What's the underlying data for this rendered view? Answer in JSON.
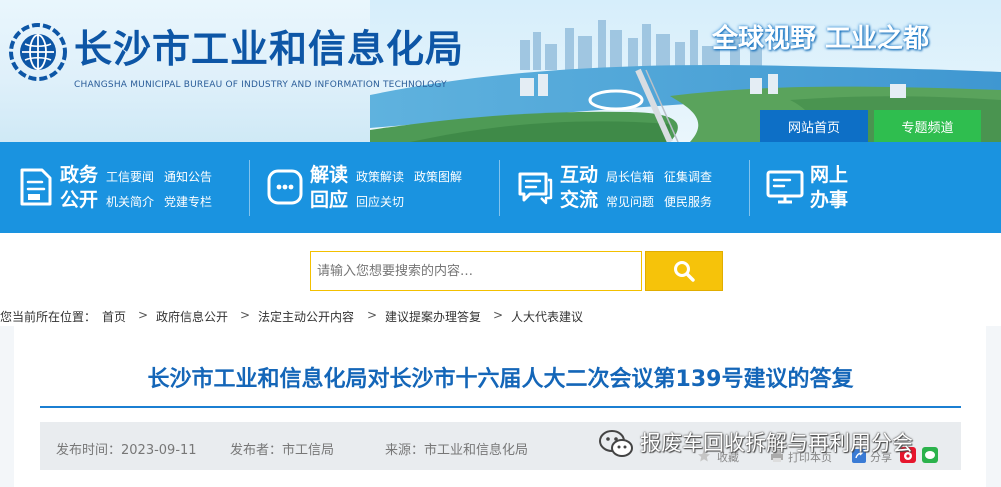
{
  "header": {
    "site_title": "长沙市工业和信息化局",
    "site_subtitle": "CHANGSHA MUNICIPAL BUREAU OF INDUSTRY AND INFORMATION TECHNOLOGY",
    "slogan": "全球视野 工业之都",
    "btn_home": "网站首页",
    "btn_topic": "专题频道",
    "colors": {
      "brand_blue": "#0d56a6",
      "nav_blue": "#1a93e0",
      "topic_green": "#2fbe4f"
    }
  },
  "nav": {
    "g1": {
      "icon": "document-icon",
      "title1": "政务",
      "title2": "公开",
      "links": [
        "工信要闻",
        "通知公告",
        "机关简介",
        "党建专栏"
      ]
    },
    "g2": {
      "icon": "interpret-icon",
      "title1": "解读",
      "title2": "回应",
      "links": [
        "政策解读",
        "政策图解",
        "回应关切"
      ]
    },
    "g3": {
      "icon": "chat-icon",
      "title1": "互动",
      "title2": "交流",
      "links": [
        "局长信箱",
        "征集调查",
        "常见问题",
        "便民服务"
      ]
    },
    "g4": {
      "icon": "monitor-icon",
      "title1": "网上",
      "title2": "办事"
    }
  },
  "search": {
    "placeholder": "请输入您想要搜索的内容…",
    "button_icon": "search-icon"
  },
  "breadcrumb": {
    "label": "您当前所在位置：",
    "items": [
      "首页",
      "政府信息公开",
      "法定主动公开内容",
      "建议提案办理答复",
      "人大代表建议"
    ],
    "separator": ">"
  },
  "article": {
    "title": "长沙市工业和信息化局对长沙市十六届人大二次会议第139号建议的答复",
    "publish_time": "发布时间：2023-09-11",
    "publisher": "发布者：市工信局",
    "source": "来源：市工业和信息化局",
    "tool_fav": "收藏",
    "tool_print": "打印本页",
    "tool_share": "分享"
  },
  "watermark": {
    "icon": "wechat-icon",
    "text": "报废车回收拆解与再利用分会"
  }
}
